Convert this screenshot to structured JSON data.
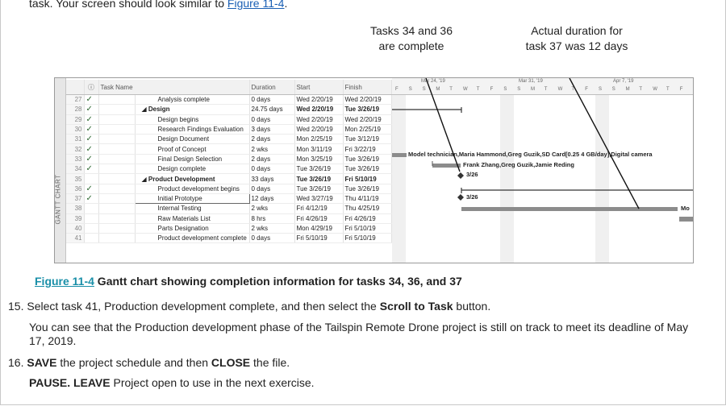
{
  "intro": {
    "prefix": "task. Your screen should look similar to ",
    "link": "Figure 11-4",
    "suffix": "."
  },
  "callouts": {
    "left_line1": "Tasks 34 and 36",
    "left_line2": "are complete",
    "right_line1": "Actual duration for",
    "right_line2": "task 37 was 12 days"
  },
  "figure": {
    "side_label": "GANTT CHART",
    "headers": {
      "info": "ⓘ",
      "name": "Task Name",
      "duration": "Duration",
      "start": "Start",
      "finish": "Finish"
    },
    "timescale": {
      "weeks": [
        "Mar 24, '19",
        "Mar 31, '19",
        "Apr 7, '19"
      ],
      "days": [
        "F",
        "S",
        "S",
        "M",
        "T",
        "W",
        "T",
        "F",
        "S",
        "S",
        "M",
        "T",
        "W",
        "T",
        "F",
        "S",
        "S",
        "M",
        "T",
        "W",
        "T",
        "F"
      ]
    },
    "rows": [
      {
        "id": "27",
        "check": "✓",
        "name": "Analysis complete",
        "duration": "0 days",
        "start": "Wed 2/20/19",
        "finish": "Wed 2/20/19",
        "level": 2,
        "bold": false
      },
      {
        "id": "28",
        "check": "✓",
        "name": "◢ Design",
        "duration": "24.75 days",
        "start": "Wed 2/20/19",
        "finish": "Tue 3/26/19",
        "level": 1,
        "bold": true
      },
      {
        "id": "29",
        "check": "✓",
        "name": "Design begins",
        "duration": "0 days",
        "start": "Wed 2/20/19",
        "finish": "Wed 2/20/19",
        "level": 2,
        "bold": false
      },
      {
        "id": "30",
        "check": "✓",
        "name": "Research Findings Evaluation",
        "duration": "3 days",
        "start": "Wed 2/20/19",
        "finish": "Mon 2/25/19",
        "level": 2,
        "bold": false
      },
      {
        "id": "31",
        "check": "✓",
        "name": "Design Document",
        "duration": "2 days",
        "start": "Mon 2/25/19",
        "finish": "Tue 3/12/19",
        "level": 2,
        "bold": false
      },
      {
        "id": "32",
        "check": "✓",
        "name": "Proof of Concept",
        "duration": "2 wks",
        "start": "Mon 3/11/19",
        "finish": "Fri 3/22/19",
        "level": 2,
        "bold": false
      },
      {
        "id": "33",
        "check": "✓",
        "name": "Final Design Selection",
        "duration": "2 days",
        "start": "Mon 3/25/19",
        "finish": "Tue 3/26/19",
        "level": 2,
        "bold": false
      },
      {
        "id": "34",
        "check": "✓",
        "name": "Design complete",
        "duration": "0 days",
        "start": "Tue 3/26/19",
        "finish": "Tue 3/26/19",
        "level": 2,
        "bold": false
      },
      {
        "id": "35",
        "check": "",
        "name": "◢ Product Development",
        "duration": "33 days",
        "start": "Tue 3/26/19",
        "finish": "Fri 5/10/19",
        "level": 1,
        "bold": true
      },
      {
        "id": "36",
        "check": "✓",
        "name": "Product development begins",
        "duration": "0 days",
        "start": "Tue 3/26/19",
        "finish": "Tue 3/26/19",
        "level": 2,
        "bold": false
      },
      {
        "id": "37",
        "check": "✓",
        "name": "Initial Prototype",
        "duration": "12 days",
        "start": "Wed 3/27/19",
        "finish": "Thu 4/11/19",
        "level": 2,
        "bold": false
      },
      {
        "id": "38",
        "check": "",
        "name": "Internal Testing",
        "duration": "2 wks",
        "start": "Fri 4/12/19",
        "finish": "Thu 4/25/19",
        "level": 2,
        "bold": false
      },
      {
        "id": "39",
        "check": "",
        "name": "Raw Materials List",
        "duration": "8 hrs",
        "start": "Fri 4/26/19",
        "finish": "Fri 4/26/19",
        "level": 2,
        "bold": false
      },
      {
        "id": "40",
        "check": "",
        "name": "Parts Designation",
        "duration": "2 wks",
        "start": "Mon 4/29/19",
        "finish": "Fri 5/10/19",
        "level": 2,
        "bold": false
      },
      {
        "id": "41",
        "check": "",
        "name": "Product development complete",
        "duration": "0 days",
        "start": "Fri 5/10/19",
        "finish": "Fri 5/10/19",
        "level": 2,
        "bold": false
      }
    ],
    "bar_labels": {
      "row32": "Model technician,Maria Hammond,Greg Guzik,SD Card[0.25 4 GB/day],Digital camera",
      "row33": "Frank Zhang,Greg Guzik,Jamie Reding",
      "row34": "3/26",
      "row36": "3/26",
      "row37": "Mo"
    }
  },
  "caption": {
    "link": "Figure 11-4",
    "text": " Gantt chart showing completion information for tasks 34, 36, and 37"
  },
  "steps": {
    "s15_num": "15.",
    "s15_a": "Select task 41, Production development complete, and then select the ",
    "s15_bold": "Scroll to Task",
    "s15_b": " button.",
    "s15_para": "You can see that the Production development phase of the Tailspin Remote Drone project is still on track to meet its deadline of May 17, 2019.",
    "s16_num": "16.",
    "s16_bold1": "SAVE",
    "s16_a": " the project schedule and then ",
    "s16_bold2": "CLOSE",
    "s16_b": " the file.",
    "pause_bold": "PAUSE. LEAVE",
    "pause_text": " Project open to use in the next exercise."
  },
  "colors": {
    "link": "#1a5fb4",
    "caption_link": "#1a8fa8",
    "check": "#2f6a33",
    "bar": "#8c8c8c"
  }
}
